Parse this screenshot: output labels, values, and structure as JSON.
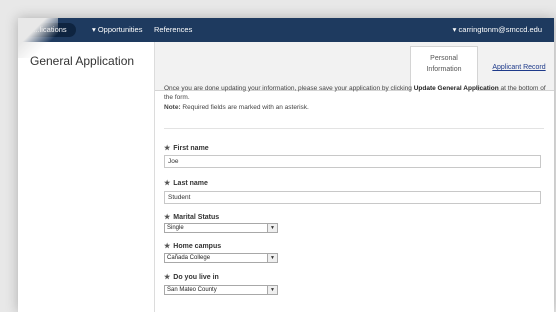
{
  "nav": {
    "items": [
      {
        "label": "...lications"
      },
      {
        "label": "▾ Opportunities"
      },
      {
        "label": "References"
      }
    ],
    "user": "▾ carringtonm@smccd.edu"
  },
  "sidebar": {
    "title": "General Application"
  },
  "tabs": {
    "active_line1": "Personal",
    "active_line2": "Information",
    "other": "Applicant Record"
  },
  "intro": {
    "before": "Once you are done updating your information, please save your application by clicking ",
    "bold": "Update General Application",
    "after": " at the bottom of the form.",
    "note_label": "Note:",
    "note_text": " Required fields are marked with an asterisk."
  },
  "form": {
    "asterisk": "★",
    "first_name": {
      "label": "First name",
      "value": "Joe"
    },
    "last_name": {
      "label": "Last name",
      "value": "Student"
    },
    "marital_status": {
      "label": "Marital Status",
      "value": "Single"
    },
    "home_campus": {
      "label": "Home campus",
      "value": "Cañada College"
    },
    "live_in": {
      "label": "Do you live in",
      "value": "San Mateo County"
    }
  }
}
